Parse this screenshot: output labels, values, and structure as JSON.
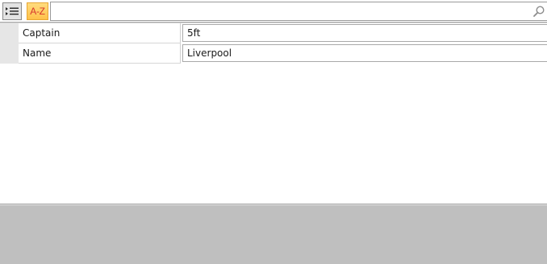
{
  "toolbar": {
    "categorized_icon": "categorized-list-icon",
    "alphabetical_label": "A-Z",
    "search": {
      "value": "",
      "placeholder": "",
      "icon": "search-icon"
    }
  },
  "properties": [
    {
      "name": "Captain",
      "value": "5ft"
    },
    {
      "name": "Name",
      "value": "Liverpool"
    }
  ],
  "description": {
    "text": ""
  },
  "colors": {
    "alphabetical_active_bg": "#ffc24a",
    "alphabetical_text": "#d6342c",
    "description_bg": "#bfbfbf"
  }
}
